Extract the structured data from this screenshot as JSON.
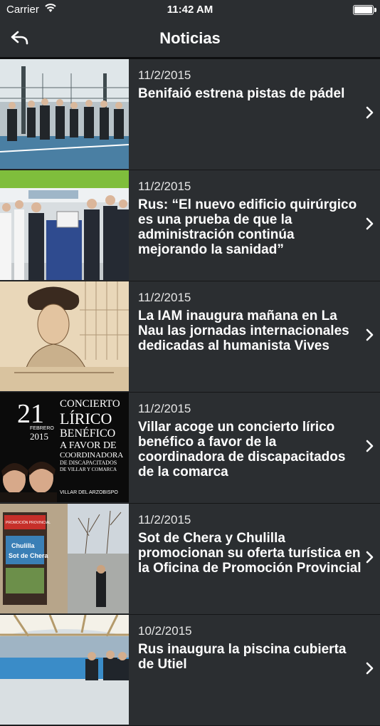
{
  "status": {
    "carrier": "Carrier",
    "time": "11:42 AM"
  },
  "nav": {
    "title": "Noticias"
  },
  "news": [
    {
      "date": "11/2/2015",
      "headline": "Benifaió estrena pistas de pádel"
    },
    {
      "date": "11/2/2015",
      "headline": "Rus: “El nuevo edificio quirúrgico es una prueba de que la administración continúa mejorando la sanidad”"
    },
    {
      "date": "11/2/2015",
      "headline": "La IAM inaugura mañana en La Nau las jornadas internacionales dedicadas al humanista Vives"
    },
    {
      "date": "11/2/2015",
      "headline": "Villar acoge un concierto lírico benéfico a favor de la coordinadora de discapacitados de la comarca"
    },
    {
      "date": "11/2/2015",
      "headline": "Sot de Chera y Chulilla promocionan su oferta turística en la Oficina de Promoción Provincial"
    },
    {
      "date": "10/2/2015",
      "headline": "Rus inaugura la piscina cubierta de Utiel"
    }
  ],
  "poster": {
    "day": "21",
    "month": "FEBRERO",
    "year": "2015",
    "l1": "CONCIERTO",
    "l2": "LÍRICO",
    "l3": "BENÉFICO",
    "l4": "A FAVOR DE",
    "l5": "COORDINADORA",
    "l6": "DE DISCAPACITADOS",
    "l7": "DE VILLAR Y COMARCA",
    "venue": "VILLAR DEL ARZOBISPO"
  },
  "signs": {
    "top": "PROMOCIÓN PROVINCIAL",
    "sign1": "Chulilla",
    "sign2": "Sot de Chera"
  }
}
